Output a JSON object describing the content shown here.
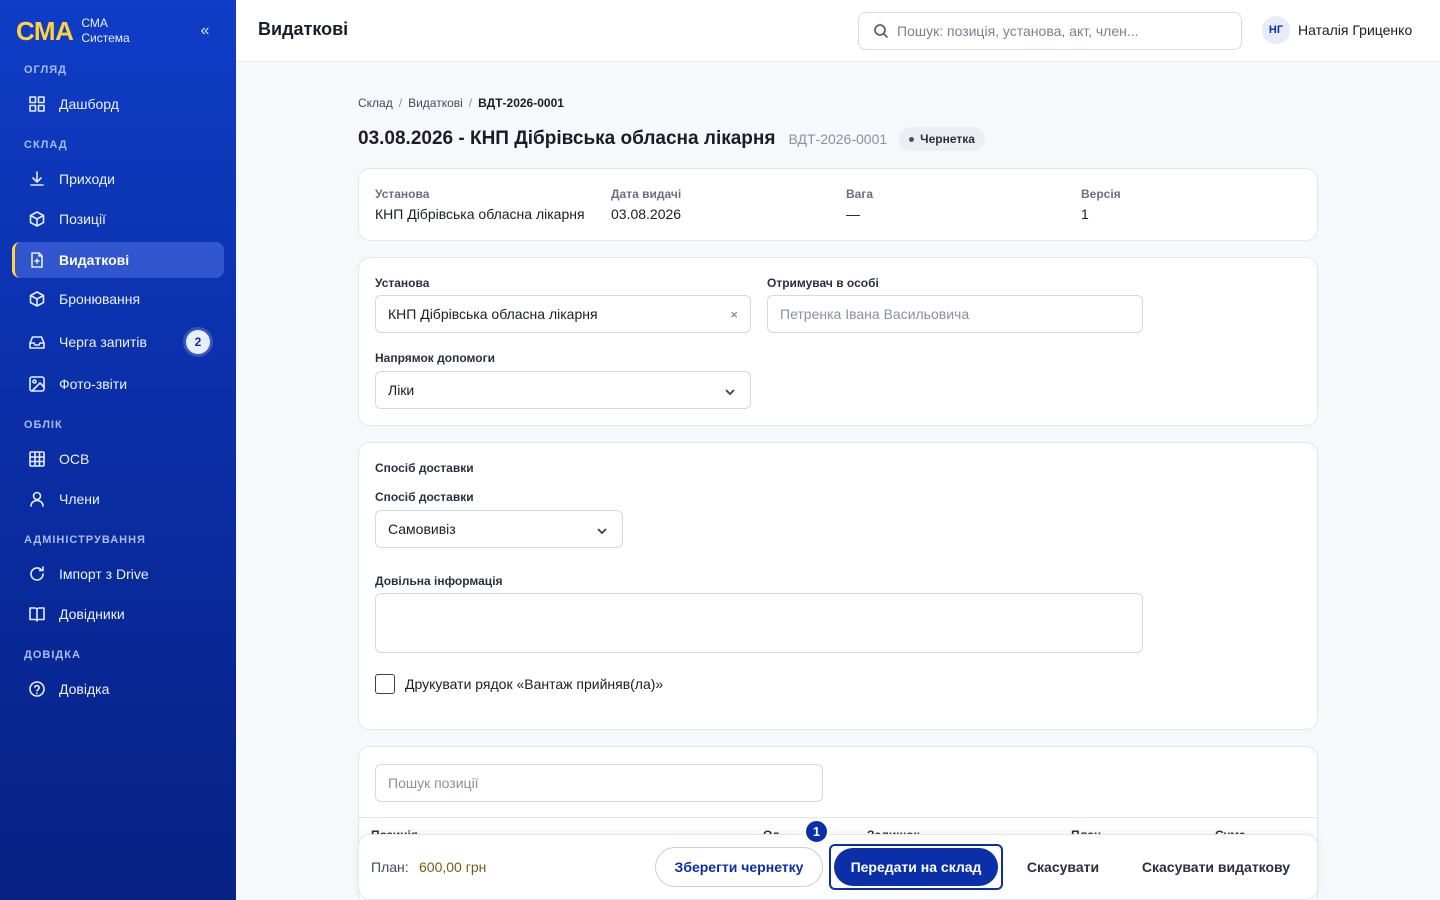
{
  "brand": {
    "logo": "СМА",
    "line1": "СМА",
    "line2": "Система",
    "collapse_glyph": "«"
  },
  "sidebar": {
    "sections": [
      {
        "label": "ОГЛЯД"
      },
      {
        "label": "СКЛАД"
      },
      {
        "label": "ОБЛІК"
      },
      {
        "label": "АДМІНІСТРУВАННЯ"
      },
      {
        "label": "ДОВІДКА"
      }
    ],
    "items": [
      {
        "label": "Дашборд",
        "icon": "grid-icon"
      },
      {
        "label": "Приходи",
        "icon": "download-icon"
      },
      {
        "label": "Позиції",
        "icon": "box-icon"
      },
      {
        "label": "Видаткові",
        "icon": "file-icon",
        "active": true
      },
      {
        "label": "Бронювання",
        "icon": "box-icon"
      },
      {
        "label": "Черга запитів",
        "icon": "inbox-icon",
        "badge": "2"
      },
      {
        "label": "Фото-звіти",
        "icon": "image-icon"
      },
      {
        "label": "ОСВ",
        "icon": "table-icon"
      },
      {
        "label": "Члени",
        "icon": "user-icon"
      },
      {
        "label": "Імпорт з Drive",
        "icon": "refresh-icon"
      },
      {
        "label": "Довідники",
        "icon": "book-icon"
      },
      {
        "label": "Довідка",
        "icon": "help-icon"
      }
    ]
  },
  "topbar": {
    "title": "Видаткові",
    "search_placeholder": "Пошук: позиція, установа, акт, член...",
    "user_initials": "НГ",
    "user_name": "Наталія Гриценко"
  },
  "breadcrumb": {
    "items": [
      "Склад",
      "Видаткові"
    ],
    "current": "ВДТ-2026-0001",
    "separator": "/"
  },
  "document": {
    "title": "03.08.2026 - КНП Дібрівська обласна лікарня",
    "code": "ВДТ-2026-0001",
    "status": "Чернетка"
  },
  "meta": [
    {
      "label": "Установа",
      "value": "КНП Дібрівська обласна лікарня"
    },
    {
      "label": "Дата видачі",
      "value": "03.08.2026"
    },
    {
      "label": "Вага",
      "value": "—"
    },
    {
      "label": "Версія",
      "value": "1"
    }
  ],
  "form": {
    "institution_label": "Установа",
    "institution_value": "КНП Дібрівська обласна лікарня",
    "clear_glyph": "×",
    "recipient_label": "Отримувач в особі",
    "recipient_placeholder": "Петренка Івана Васильовича",
    "direction_label": "Напрямок допомоги",
    "direction_value": "Ліки"
  },
  "delivery": {
    "section_title": "Спосіб доставки",
    "method_label": "Спосіб доставки",
    "method_value": "Самовивіз",
    "info_label": "Довільна інформація",
    "print_checkbox_label": "Друкувати рядок «Вантаж прийняв(ла)»"
  },
  "items_table": {
    "search_placeholder": "Пошук позиції",
    "columns": [
      "Позиція",
      "Од.",
      "Залишок",
      "План",
      "Сума"
    ]
  },
  "footer": {
    "plan_label": "План:",
    "plan_value": "600,00 грн",
    "save_draft": "Зберегти чернетку",
    "submit": "Передати на склад",
    "cancel": "Скасувати",
    "cancel_expense": "Скасувати видаткову",
    "step_marker": "1"
  },
  "colors": {
    "sidebar": "#0a2fa8",
    "accent": "#ffd23f",
    "primary": "#0a2fa8",
    "plan_value": "#7a5b0e"
  }
}
